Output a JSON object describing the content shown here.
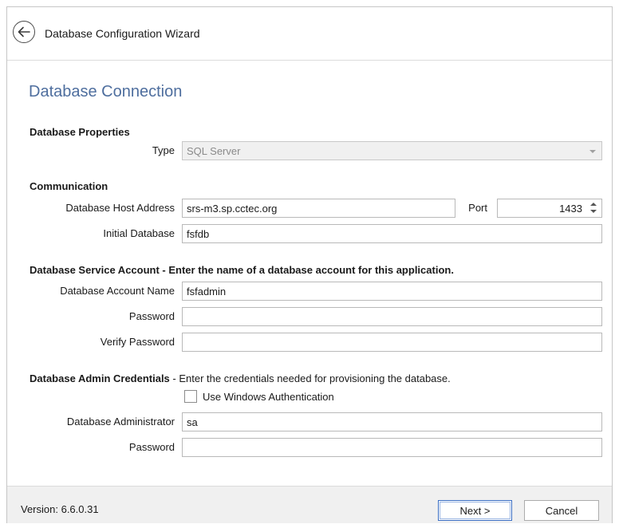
{
  "header": {
    "title": "Database Configuration Wizard",
    "back_icon": "arrow-left-circle-icon"
  },
  "page": {
    "title": "Database Connection"
  },
  "database_properties": {
    "title": "Database Properties",
    "type_label": "Type",
    "type_value": "SQL Server"
  },
  "communication": {
    "title": "Communication",
    "host_label": "Database Host Address",
    "host_value": "srs-m3.sp.cctec.org",
    "port_label": "Port",
    "port_value": "1433",
    "initial_db_label": "Initial Database",
    "initial_db_value": "fsfdb"
  },
  "service_account": {
    "title": "Database Service Account - Enter the name of a database account for this application.",
    "account_name_label": "Database Account Name",
    "account_name_value": "fsfadmin",
    "password_label": "Password",
    "password_value": "",
    "verify_label": "Verify Password",
    "verify_value": ""
  },
  "admin_credentials": {
    "title": "Database Admin Credentials",
    "description": " - Enter the credentials needed for provisioning the database.",
    "windows_auth_label": "Use Windows Authentication",
    "windows_auth_checked": false,
    "admin_label": "Database Administrator",
    "admin_value": "sa",
    "password_label": "Password",
    "password_value": ""
  },
  "footer": {
    "version": "Version: 6.6.0.31",
    "next_label": "Next >",
    "cancel_label": "Cancel"
  }
}
